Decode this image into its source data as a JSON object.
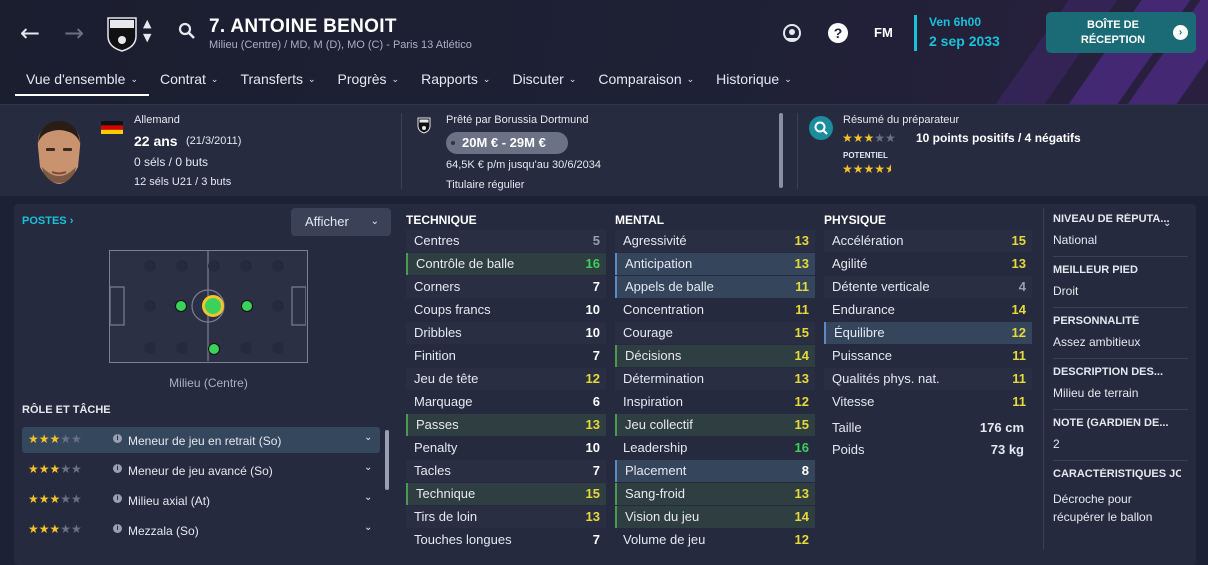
{
  "header": {
    "back_icon": "arrow-left-icon",
    "forward_icon": "arrow-right-icon",
    "player_name": "7. ANTOINE BENOIT",
    "player_subtitle": "Milieu (Centre) / MD, M (D), MO (C) - Paris 13 Atlético",
    "fm_label": "FM",
    "date_day": "Ven 6h00",
    "date_full": "2 sep 2033",
    "inbox_line1": "BOÎTE DE",
    "inbox_line2": "RÉCEPTION",
    "accent": "#19c1d9"
  },
  "menu": [
    {
      "label": "Vue d'ensemble",
      "active": true
    },
    {
      "label": "Contrat"
    },
    {
      "label": "Transferts"
    },
    {
      "label": "Progrès"
    },
    {
      "label": "Rapports"
    },
    {
      "label": "Discuter"
    },
    {
      "label": "Comparaison"
    },
    {
      "label": "Historique"
    }
  ],
  "info": {
    "nationality": "Allemand",
    "age": "22 ans",
    "dob": "(21/3/2011)",
    "caps": "0 séls / 0 buts",
    "u21": "12 séls U21 / 3 buts",
    "loan": "Prêté par Borussia Dortmund",
    "value": "20M € - 29M €",
    "wage": "64,5K € p/m jusqu'au 30/6/2034",
    "status": "Titulaire régulier",
    "coach_title": "Résumé du préparateur",
    "coach_summary": "10 points positifs / 4 négatifs",
    "potential_label": "POTENTIEL",
    "current_stars": 3,
    "potential_stars": 4.5
  },
  "positions": {
    "title": "POSTES",
    "show_label": "Afficher",
    "position_name": "Milieu (Centre)",
    "roles_title": "RÔLE ET TÂCHE",
    "roles": [
      {
        "label": "Meneur de jeu en retrait (So)",
        "stars": 3
      },
      {
        "label": "Meneur de jeu avancé (So)",
        "stars": 3
      },
      {
        "label": "Milieu axial (At)",
        "stars": 3
      },
      {
        "label": "Mezzala (So)",
        "stars": 3
      }
    ]
  },
  "technique": {
    "title": "TECHNIQUE",
    "items": [
      {
        "name": "Centres",
        "value": "5"
      },
      {
        "name": "Contrôle de balle",
        "value": "16"
      },
      {
        "name": "Corners",
        "value": "7"
      },
      {
        "name": "Coups francs",
        "value": "10"
      },
      {
        "name": "Dribbles",
        "value": "10"
      },
      {
        "name": "Finition",
        "value": "7"
      },
      {
        "name": "Jeu de tête",
        "value": "12"
      },
      {
        "name": "Marquage",
        "value": "6"
      },
      {
        "name": "Passes",
        "value": "13"
      },
      {
        "name": "Penalty",
        "value": "10"
      },
      {
        "name": "Tacles",
        "value": "7"
      },
      {
        "name": "Technique",
        "value": "15"
      },
      {
        "name": "Tirs de loin",
        "value": "13"
      },
      {
        "name": "Touches longues",
        "value": "7"
      }
    ]
  },
  "mental": {
    "title": "MENTAL",
    "items": [
      {
        "name": "Agressivité",
        "value": "13"
      },
      {
        "name": "Anticipation",
        "value": "13"
      },
      {
        "name": "Appels de balle",
        "value": "11"
      },
      {
        "name": "Concentration",
        "value": "11"
      },
      {
        "name": "Courage",
        "value": "15"
      },
      {
        "name": "Décisions",
        "value": "14"
      },
      {
        "name": "Détermination",
        "value": "13"
      },
      {
        "name": "Inspiration",
        "value": "12"
      },
      {
        "name": "Jeu collectif",
        "value": "15"
      },
      {
        "name": "Leadership",
        "value": "16"
      },
      {
        "name": "Placement",
        "value": "8"
      },
      {
        "name": "Sang-froid",
        "value": "13"
      },
      {
        "name": "Vision du jeu",
        "value": "14"
      },
      {
        "name": "Volume de jeu",
        "value": "12"
      }
    ]
  },
  "physique": {
    "title": "PHYSIQUE",
    "items": [
      {
        "name": "Accélération",
        "value": "15"
      },
      {
        "name": "Agilité",
        "value": "13"
      },
      {
        "name": "Détente verticale",
        "value": "4"
      },
      {
        "name": "Endurance",
        "value": "14"
      },
      {
        "name": "Équilibre",
        "value": "12"
      },
      {
        "name": "Puissance",
        "value": "11"
      },
      {
        "name": "Qualités phys. nat.",
        "value": "11"
      },
      {
        "name": "Vitesse",
        "value": "11"
      }
    ],
    "height_label": "Taille",
    "height": "176 cm",
    "weight_label": "Poids",
    "weight": "73 kg"
  },
  "side": {
    "reputation_label": "NIVEAU DE RÉPUTA...",
    "reputation": "National",
    "foot_label": "MEILLEUR PIED",
    "foot": "Droit",
    "personality_label": "PERSONNALITÉ",
    "personality": "Assez ambitieux",
    "description_label": "DESCRIPTION DES...",
    "description": "Milieu de terrain",
    "gk_label": "NOTE (GARDIEN DE...",
    "gk": "2",
    "traits_label": "CARACTÉRISTIQUES JO",
    "traits": "Décroche pour récupérer le ballon"
  }
}
